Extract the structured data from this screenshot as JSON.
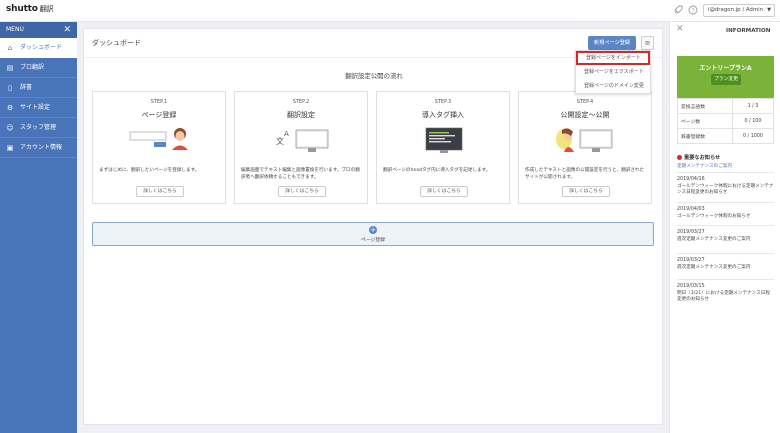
{
  "app": {
    "logo": "shutto",
    "logo_sub": "翻訳",
    "user": "i@dragon.jp / Admin"
  },
  "sidebar": {
    "menu_label": "MENU",
    "items": [
      {
        "label": "ダッシュボード",
        "icon": "home-icon",
        "active": true
      },
      {
        "label": "プロ翻訳",
        "icon": "pro-translate-icon"
      },
      {
        "label": "辞書",
        "icon": "dictionary-icon"
      },
      {
        "label": "サイト設定",
        "icon": "site-settings-icon"
      },
      {
        "label": "スタッフ管理",
        "icon": "staff-icon"
      },
      {
        "label": "アカウント情報",
        "icon": "account-icon"
      }
    ]
  },
  "main": {
    "title": "ダッシュボード",
    "new_page_button": "新規ページ登録",
    "dropdown": [
      "登録ページをインポート",
      "登録ページをエクスポート",
      "登録ページのドメイン変更"
    ],
    "flow_title": "翻訳設定公開の流れ",
    "steps": [
      {
        "label": "STEP.1",
        "title": "ページ登録",
        "desc": "まずはじめに、翻訳したいページを登録します。",
        "more": "詳しくはこちら"
      },
      {
        "label": "STEP.2",
        "title": "翻訳設定",
        "desc": "編集画面でテキスト編集と画像置換を行います。プロの翻訳者へ翻訳依頼することもできます。",
        "more": "詳しくはこちら"
      },
      {
        "label": "STEP.3",
        "title": "導入タグ挿入",
        "desc": "翻訳ページのheadタグ内に導入タグを記述します。",
        "more": "詳しくはこちら"
      },
      {
        "label": "STEP.4",
        "title": "公開設定～公開",
        "desc": "作成したテキストと画像の公開設定を行うと、翻訳されたサイトが公開されます。",
        "more": "詳しくはこちら"
      }
    ],
    "add_page_label": "ページ登録"
  },
  "info": {
    "title": "INFORMATION",
    "plan_name": "エントリープランA",
    "plan_button": "プラン変更",
    "stats": [
      {
        "label": "変換言語数",
        "value": "1 / 3"
      },
      {
        "label": "ページ数",
        "value": "0 / 100"
      },
      {
        "label": "辞書登録数",
        "value": "0 / 1000"
      }
    ],
    "notice_head": "重要なお知らせ",
    "notice_link": "定期メンテナンスのご案内",
    "news": [
      {
        "date": "2019/04/16",
        "text": "ゴールデンウィーク休暇における定期メンテナンス日程変更のお知らせ"
      },
      {
        "date": "2019/04/03",
        "text": "ゴールデンウィーク休暇のお知らせ"
      },
      {
        "date": "2019/03/27",
        "text": "週次定期メンテナンス変更のご案内"
      },
      {
        "date": "2019/03/27",
        "text": "週次定期メンテナンス変更のご案内"
      },
      {
        "date": "2019/03/15",
        "text": "明日（3/21）における定期メンテナンス日程変更のお知らせ"
      }
    ]
  },
  "colors": {
    "sidebar": "#4a74b9",
    "accent": "#5b86c6",
    "plan": "#7bb33a",
    "highlight": "#d9262b"
  }
}
